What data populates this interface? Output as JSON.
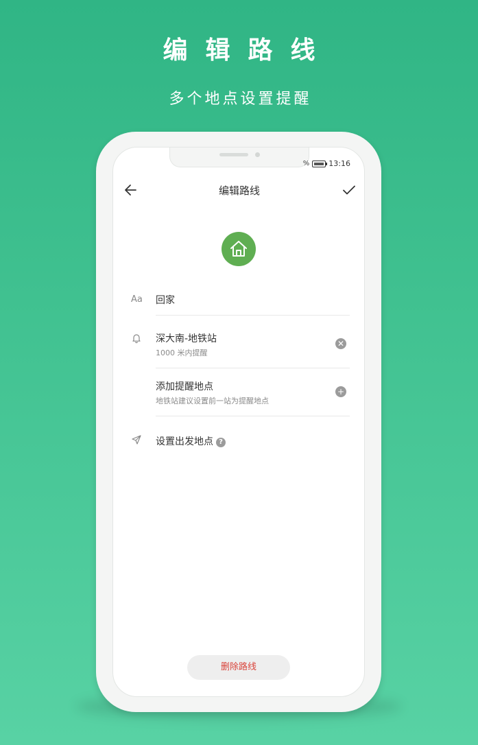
{
  "promo": {
    "headline": "编辑路线",
    "subline": "多个地点设置提醒"
  },
  "statusbar": {
    "battery_text": "%",
    "time": "13:16"
  },
  "appbar": {
    "title": "编辑路线",
    "back_icon": "arrow-left-icon",
    "confirm_icon": "checkmark-icon"
  },
  "route": {
    "icon": "home-icon",
    "icon_color": "#5fae52",
    "name_prefix_icon": "Aa",
    "name": "回家"
  },
  "reminders": [
    {
      "title": "深大南-地铁站",
      "subtitle": "1000 米内提醒",
      "action_icon": "remove-icon"
    },
    {
      "title": "添加提醒地点",
      "subtitle": "地铁站建议设置前一站为提醒地点",
      "action_icon": "add-icon"
    }
  ],
  "departure": {
    "label": "设置出发地点",
    "help": "?"
  },
  "delete_button": {
    "label": "删除路线",
    "color": "#d9443b"
  },
  "colors": {
    "background_top": "#30b585",
    "background_bottom": "#58d2a4"
  }
}
